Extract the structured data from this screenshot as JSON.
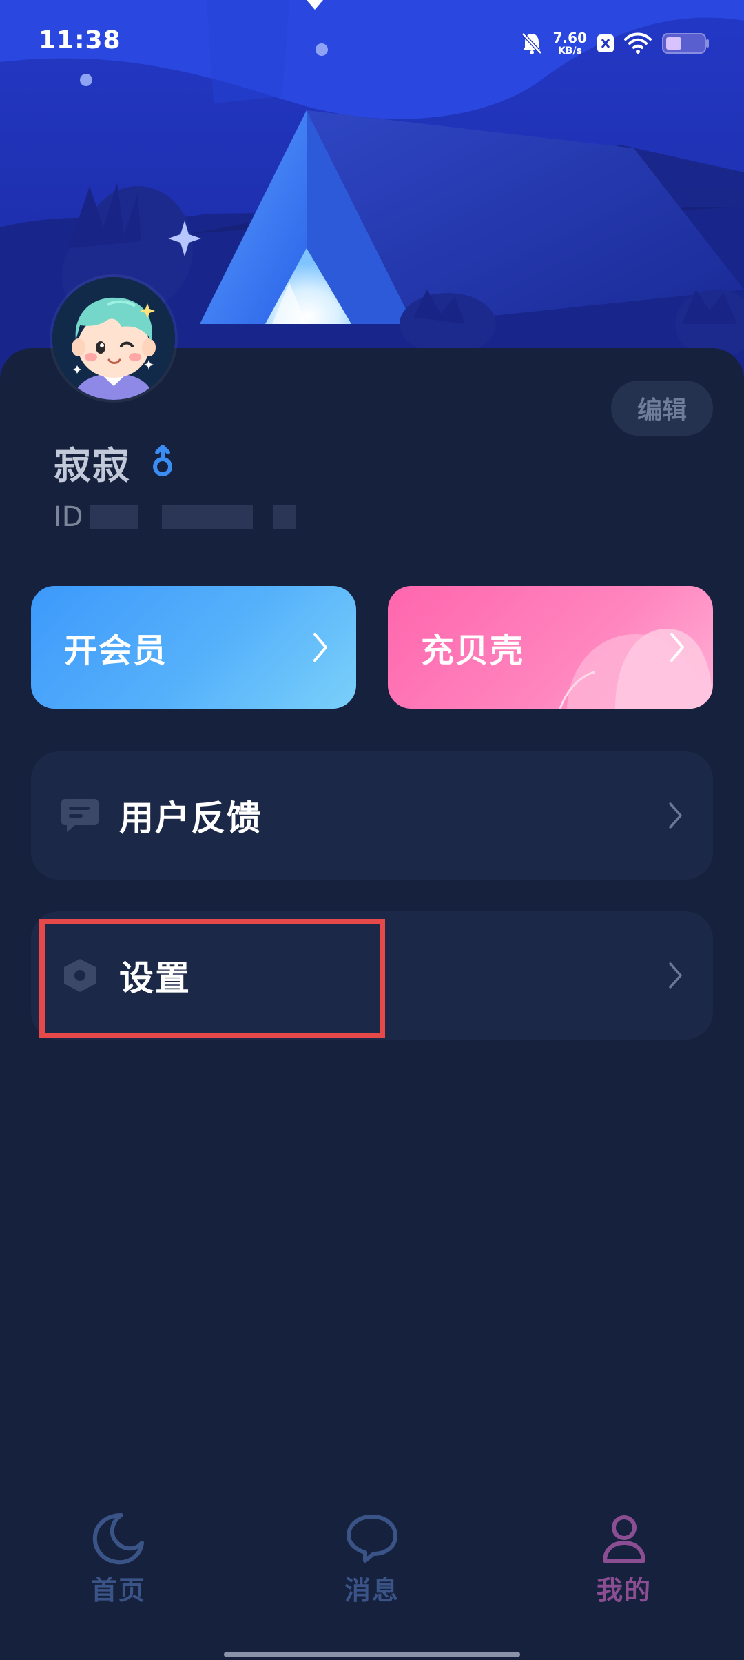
{
  "status_bar": {
    "time": "11:38",
    "net_speed_value": "7.60",
    "net_speed_unit": "KB/s",
    "icons": [
      "bell-muted-icon",
      "app-badge-icon",
      "wifi-icon",
      "battery-icon"
    ]
  },
  "profile": {
    "username": "寂寂",
    "gender_icon": "male-icon",
    "id_label": "ID",
    "edit_label": "编辑"
  },
  "promos": {
    "vip_label": "开会员",
    "coins_label": "充贝壳"
  },
  "menu": {
    "feedback_label": "用户反馈",
    "settings_label": "设置"
  },
  "tabs": [
    {
      "label": "首页",
      "icon": "moon-icon",
      "active": false
    },
    {
      "label": "消息",
      "icon": "chat-bubble-icon",
      "active": false
    },
    {
      "label": "我的",
      "icon": "person-icon",
      "active": true
    }
  ],
  "colors": {
    "background": "#16213d",
    "vip_gradient": [
      "#3d99fb",
      "#7ad0fa"
    ],
    "coins_gradient": [
      "#ff66ad",
      "#ffb1d6"
    ],
    "tab_inactive": "#3b5488",
    "tab_active": "#8b4e93",
    "highlight": "#e5494a"
  }
}
